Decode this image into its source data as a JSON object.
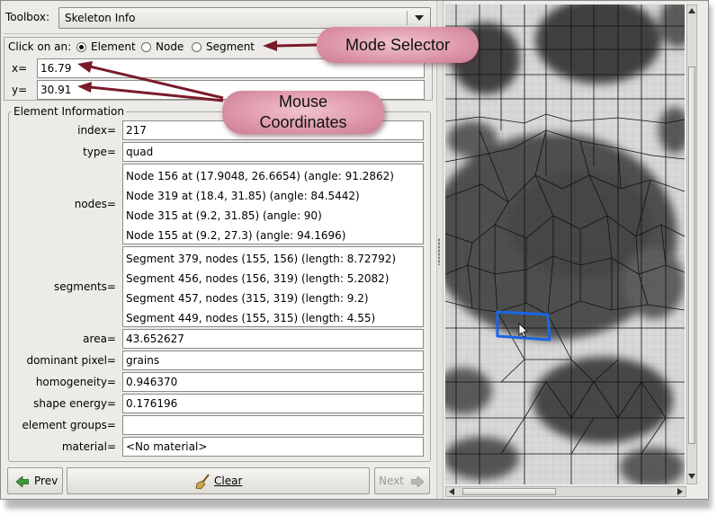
{
  "toolbox": {
    "label": "Toolbox:",
    "selected": "Skeleton Info"
  },
  "mode": {
    "prompt": "Click on an:",
    "options": [
      "Element",
      "Node",
      "Segment"
    ],
    "selected": "Element"
  },
  "coords": {
    "x_label": "x=",
    "x_value": "16.79",
    "y_label": "y=",
    "y_value": "30.91"
  },
  "element_info": {
    "title": "Element Information",
    "index_label": "index=",
    "index": "217",
    "type_label": "type=",
    "type": "quad",
    "nodes_label": "nodes=",
    "nodes": [
      "Node 156 at (17.9048, 26.6654) (angle: 91.2862)",
      "Node 319 at (18.4, 31.85) (angle: 84.5442)",
      "Node 315 at (9.2, 31.85) (angle: 90)",
      "Node 155 at (9.2, 27.3) (angle: 94.1696)"
    ],
    "segments_label": "segments=",
    "segments": [
      "Segment 379, nodes (155, 156) (length: 8.72792)",
      "Segment 456, nodes (156, 319) (length: 5.2082)",
      "Segment 457, nodes (315, 319) (length: 9.2)",
      "Segment 449, nodes (155, 315) (length: 4.55)"
    ],
    "area_label": "area=",
    "area": "43.652627",
    "dominant_label": "dominant pixel=",
    "dominant": "grains",
    "homogeneity_label": "homogeneity=",
    "homogeneity": "0.946370",
    "shape_energy_label": "shape energy=",
    "shape_energy": "0.176196",
    "groups_label": "element groups=",
    "groups": "",
    "material_label": "material=",
    "material": "<No material>"
  },
  "buttons": {
    "prev": "Prev",
    "clear": "Clear",
    "next": "Next"
  },
  "callouts": {
    "mode": "Mode Selector",
    "mouse_line1": "Mouse",
    "mouse_line2": "Coordinates"
  },
  "colors": {
    "selection": "#1a66e6",
    "arrow": "#7a1b2a",
    "callout": "#d98ea2"
  }
}
